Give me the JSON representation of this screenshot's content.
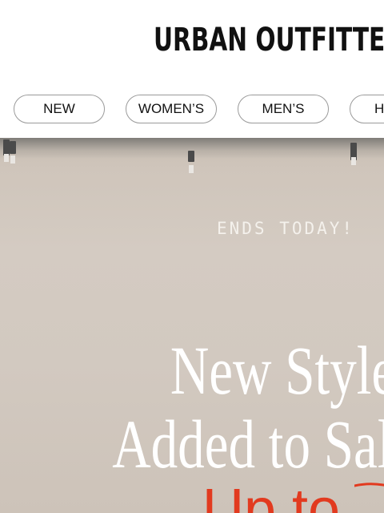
{
  "brand": {
    "logo_text": "URBAN OUTFITTERS"
  },
  "nav": {
    "items": [
      {
        "label": "NEW"
      },
      {
        "label": "WOMEN’S"
      },
      {
        "label": "MEN’S"
      },
      {
        "label": "HOME"
      }
    ]
  },
  "hero": {
    "eyebrow": "ENDS TODAY!",
    "headline_line1": "New Styles",
    "headline_line2": "Added to Sale",
    "sale_text": "Up to",
    "colors": {
      "background": "#d2c9c0",
      "headline": "#ffffff",
      "accent": "#e23a1f"
    }
  }
}
